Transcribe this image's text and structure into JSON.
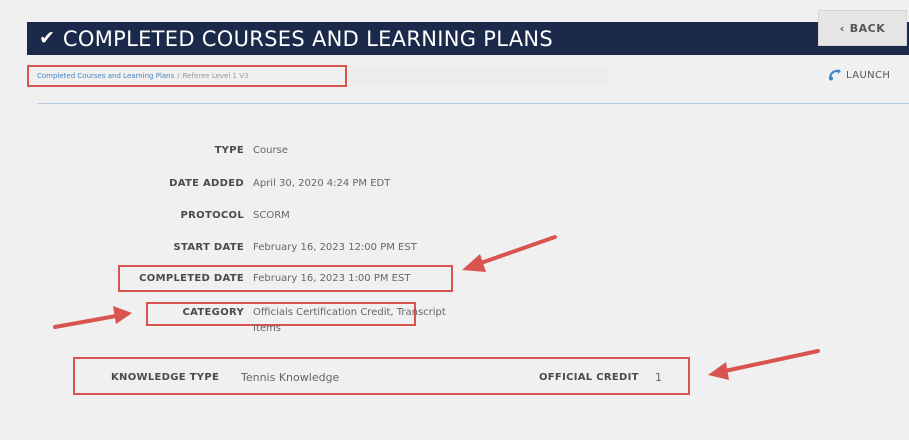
{
  "header": {
    "title": "COMPLETED COURSES AND LEARNING PLANS",
    "back_label": "BACK"
  },
  "breadcrumb": {
    "parent": "Completed Courses and Learning Plans",
    "separator": "/",
    "current": "Referee Level 1 V3"
  },
  "launch_label": "LAUNCH",
  "details": [
    {
      "label": "TYPE",
      "value": "Course"
    },
    {
      "label": "DATE ADDED",
      "value": "April 30, 2020 4:24 PM EDT"
    },
    {
      "label": "PROTOCOL",
      "value": "SCORM"
    },
    {
      "label": "START DATE",
      "value": "February 16, 2023 12:00 PM EST"
    },
    {
      "label": "COMPLETED DATE",
      "value": "February 16, 2023 1:00 PM EST"
    },
    {
      "label": "CATEGORY",
      "value_line1": "Officials Certification Credit, Transcript",
      "value_line2": "Items"
    }
  ],
  "knowledge_type": {
    "label": "KNOWLEDGE TYPE",
    "value": "Tennis Knowledge"
  },
  "official_credit": {
    "label": "OFFICIAL CREDIT",
    "value": "1"
  },
  "colors": {
    "header_bg": "#1b2a4a",
    "annotation_red": "#d9534f",
    "link_blue": "#4a84c4"
  }
}
